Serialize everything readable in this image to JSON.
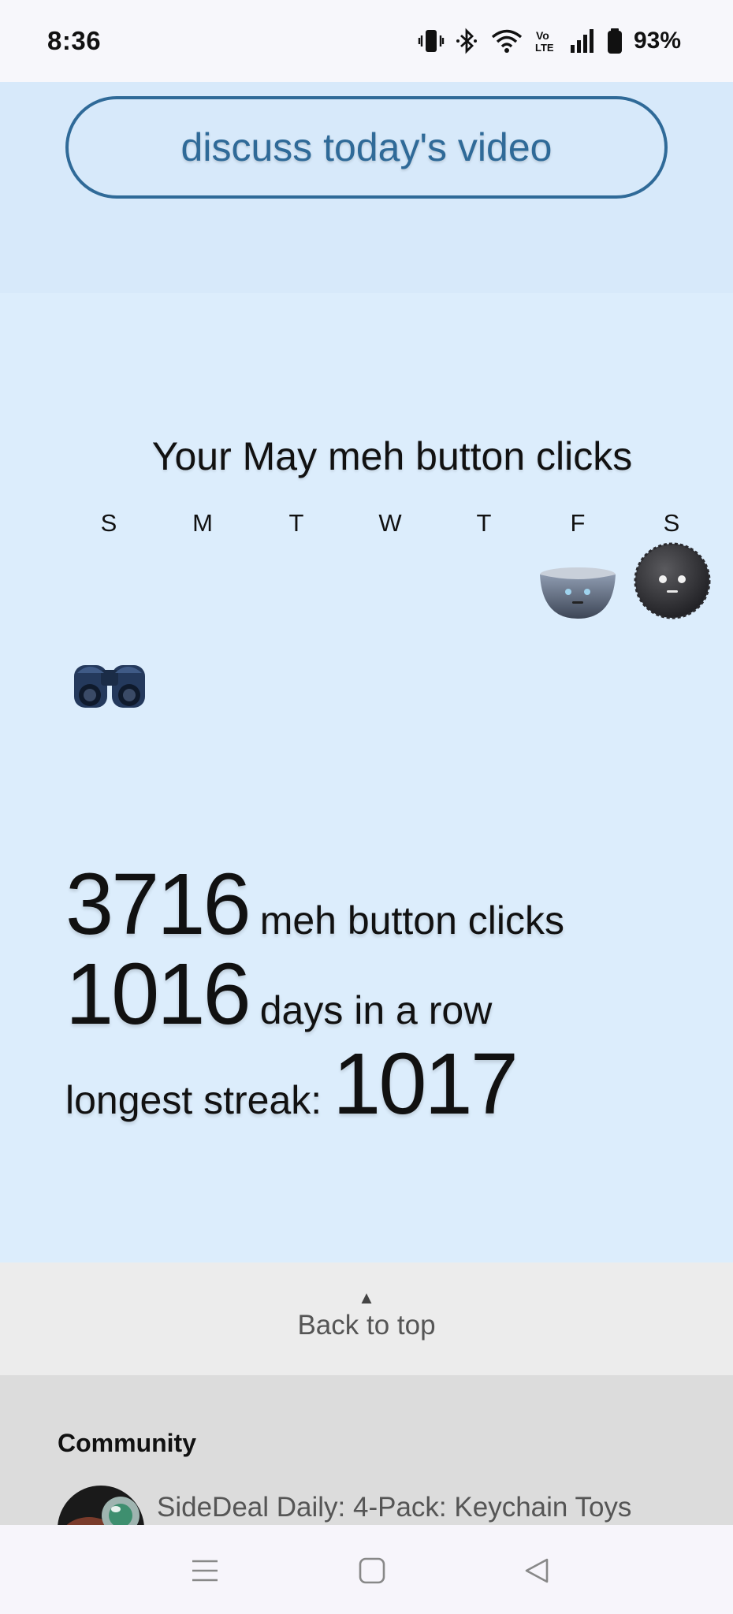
{
  "status_bar": {
    "time": "8:36",
    "battery": "93%",
    "icons": [
      "vibrate-icon",
      "bluetooth-icon",
      "wifi-icon",
      "volte-icon",
      "signal-icon",
      "battery-icon"
    ]
  },
  "hero": {
    "discuss_label": "discuss today's video"
  },
  "clicks": {
    "title": "Your May meh button clicks",
    "weekdays": [
      "S",
      "M",
      "T",
      "W",
      "T",
      "F",
      "S"
    ],
    "calendar_icons": [
      "bowl-icon",
      "dark-cookie-icon",
      "binoculars-icon"
    ],
    "stats": {
      "total_clicks": "3716",
      "total_clicks_label": "meh button clicks",
      "streak_days": "1016",
      "streak_days_label": "days in a row",
      "longest_label": "longest streak:",
      "longest_value": "1017"
    }
  },
  "back_to_top": {
    "arrow": "▲",
    "label": "Back to top"
  },
  "community": {
    "title": "Community",
    "items": [
      {
        "text": "SideDeal Daily: 4-Pack: Keychain Toys"
      }
    ]
  },
  "navbar": {
    "icons": [
      "menu-icon",
      "home-icon",
      "back-icon"
    ]
  },
  "colors": {
    "accent": "#2f6a98",
    "hero_bg": "#d7e9fa",
    "clicks_bg": "#dcedfc",
    "backtop_bg": "#ececec",
    "community_bg": "#dcdcdc"
  }
}
